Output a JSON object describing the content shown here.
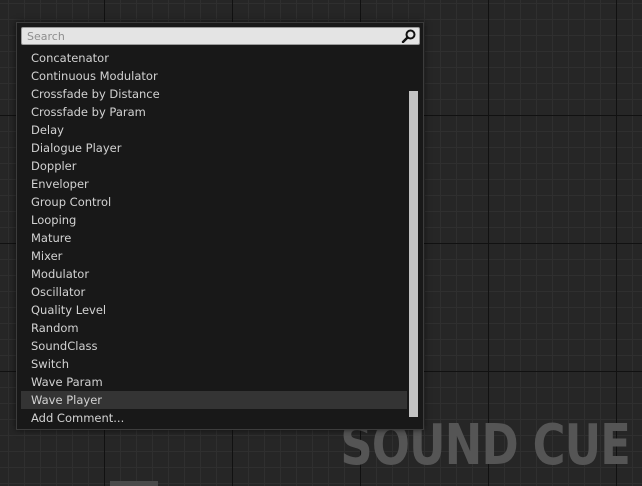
{
  "watermark": "SOUND CUE",
  "search": {
    "placeholder": "Search",
    "value": ""
  },
  "menu": {
    "items": [
      {
        "label": "Concatenator"
      },
      {
        "label": "Continuous Modulator"
      },
      {
        "label": "Crossfade by Distance"
      },
      {
        "label": "Crossfade by Param"
      },
      {
        "label": "Delay"
      },
      {
        "label": "Dialogue Player"
      },
      {
        "label": "Doppler"
      },
      {
        "label": "Enveloper"
      },
      {
        "label": "Group Control"
      },
      {
        "label": "Looping"
      },
      {
        "label": "Mature"
      },
      {
        "label": "Mixer"
      },
      {
        "label": "Modulator"
      },
      {
        "label": "Oscillator"
      },
      {
        "label": "Quality Level"
      },
      {
        "label": "Random"
      },
      {
        "label": "SoundClass"
      },
      {
        "label": "Switch"
      },
      {
        "label": "Wave Param"
      },
      {
        "label": "Wave Player",
        "selected": true
      },
      {
        "label": "Add Comment..."
      }
    ]
  },
  "colors": {
    "menu_background": "#181818",
    "selected_row": "#343434",
    "text": "#d2d2d2",
    "watermark": "#555555"
  },
  "icons": {
    "search": "search-icon"
  }
}
